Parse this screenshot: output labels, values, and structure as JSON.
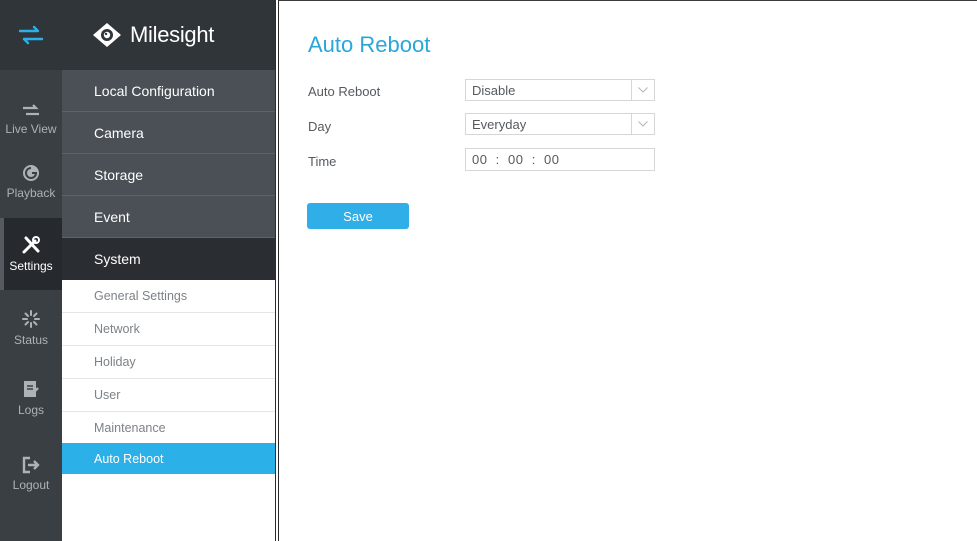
{
  "app": {
    "brand": "Milesight"
  },
  "rail": {
    "items": [
      {
        "label": "Live View",
        "icon": "live-view-icon"
      },
      {
        "label": "Playback",
        "icon": "playback-icon"
      },
      {
        "label": "Settings",
        "icon": "settings-icon"
      },
      {
        "label": "Status",
        "icon": "status-icon"
      },
      {
        "label": "Logs",
        "icon": "logs-icon"
      },
      {
        "label": "Logout",
        "icon": "logout-icon"
      }
    ],
    "active": "Settings"
  },
  "subnav": {
    "sections": [
      {
        "label": "Local Configuration"
      },
      {
        "label": "Camera"
      },
      {
        "label": "Storage"
      },
      {
        "label": "Event"
      },
      {
        "label": "System"
      }
    ],
    "system_items": [
      {
        "label": "General Settings"
      },
      {
        "label": "Network"
      },
      {
        "label": "Holiday"
      },
      {
        "label": "User"
      },
      {
        "label": "Maintenance"
      },
      {
        "label": "Auto Reboot"
      }
    ],
    "active_item": "Auto Reboot"
  },
  "main": {
    "title": "Auto Reboot",
    "fields": {
      "auto_reboot": {
        "label": "Auto Reboot",
        "value": "Disable"
      },
      "day": {
        "label": "Day",
        "value": "Everyday"
      },
      "time": {
        "label": "Time",
        "value": "00  :  00  :  00"
      }
    },
    "save_label": "Save"
  },
  "colors": {
    "accent": "#2cb0e8",
    "rail_bg": "#3a3f44",
    "section_bg": "#4a5056",
    "system_bg": "#2a2e32"
  }
}
